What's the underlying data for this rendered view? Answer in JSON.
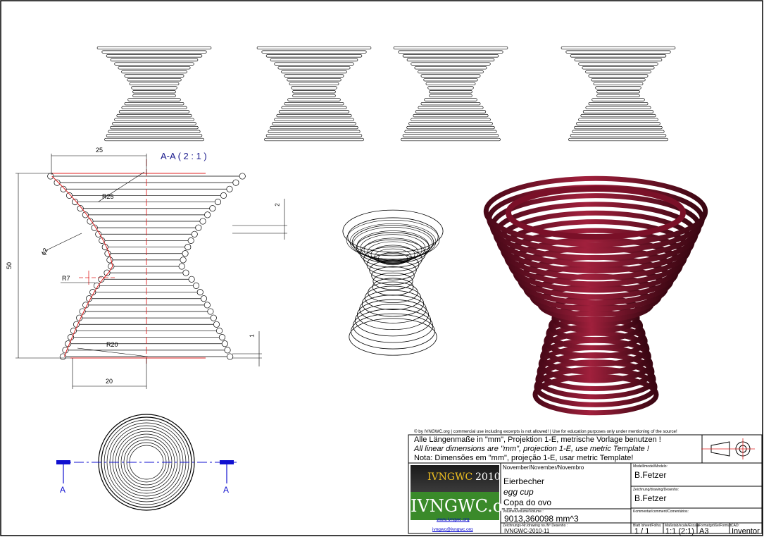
{
  "drawing": {
    "section_label": "A-A ( 2 : 1 )",
    "dims": {
      "top_width": "25",
      "height": "50",
      "bottom_width": "20",
      "pitch": "2",
      "offset": "1",
      "r25": "R25",
      "r7": "R7",
      "r20": "R20",
      "phi2": "ϕ2"
    },
    "cut_label_left": "A",
    "cut_label_right": "A"
  },
  "title_block": {
    "copyright": "© by IVNGWC.org | commercial use including excerpts is not allowed! | Use for education purposes only under mentioning of the source!",
    "note_de": "Alle Längenmaße in \"mm\", Projektion 1-E, metrische Vorlage benutzen !",
    "note_en": "All linear dimensions are \"mm\", projection 1-E, use metric Template !",
    "note_pt": "Nota: Dimensões em \"mm\", projeção 1-E, usar metric Template!",
    "logo_text": "IVNGWC",
    "logo_year": "2010",
    "logo_org": "IVNGWC.org",
    "link_web": "www.ivngwc.org",
    "link_mail": "ivngwc@ivngwc.org",
    "month": "November/November/Novembro",
    "title_de": "Eierbecher",
    "title_en": "egg cup",
    "title_pt": "Copa do ovo",
    "volume_label": "Volumen/volume/Volume :",
    "volume": "9013,360098 mm^3",
    "drawing_no_label": "Zeichnungs-Nr./drawing no./Nº Desenho :",
    "drawing_no": "IVNGWC-2010-11",
    "model_label": "Modell/model/Modelo:",
    "model": "B.Fetzer",
    "drawn_label": "Zeichnung/drawing/Desenho:",
    "drawn": "B.Fetzer",
    "comment_label": "Kommentar/comment/Comentários:",
    "sheet_label": "Blatt /sheet/Folha:",
    "sheet": "1 / 1",
    "scale_label": "Maßstab/scale/Escala:",
    "scale": "1:1 (2:1)",
    "format_label": "Formatgröße/Format:",
    "format": "A3",
    "cad_label": "CAD:",
    "cad": "Inventor"
  },
  "colors": {
    "line": "#000000",
    "red": "#e02020",
    "blue": "#1010d0",
    "maroon": "#7a1028",
    "logo_green": "#3a8a2a",
    "logo_gold": "#f0c020"
  }
}
